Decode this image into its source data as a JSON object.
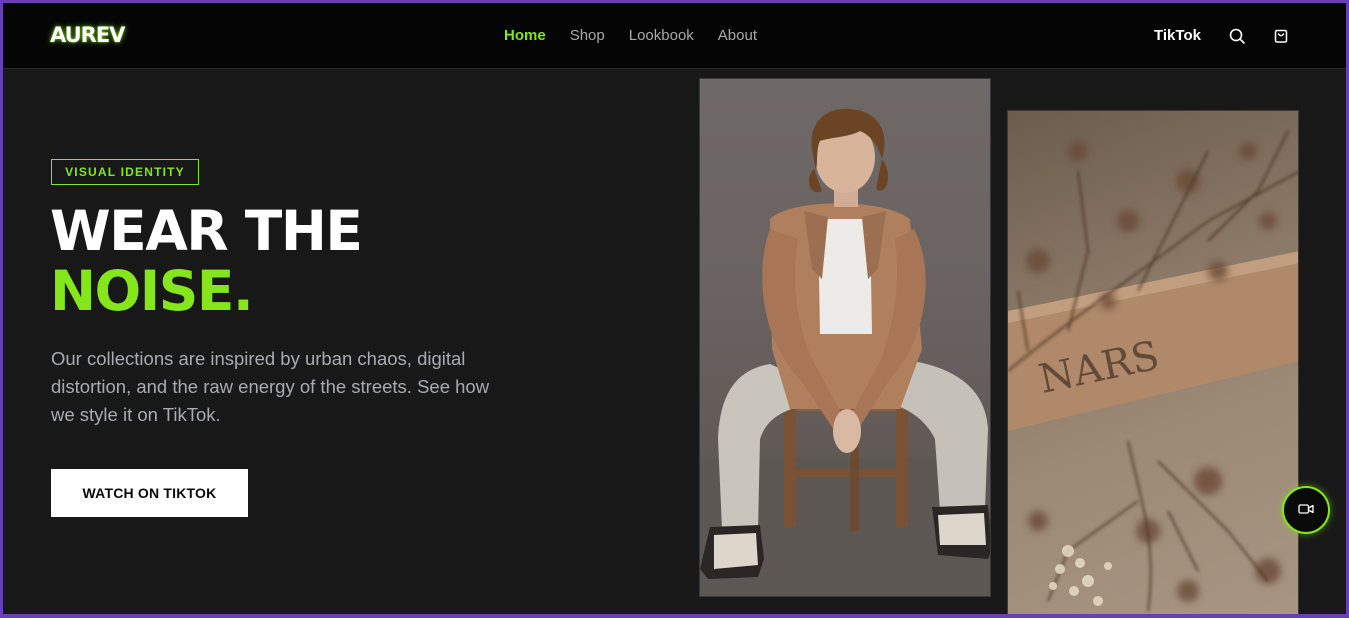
{
  "brand": {
    "logo": "AUREV",
    "accent_color": "#84e61b"
  },
  "nav": {
    "items": [
      {
        "label": "Home",
        "active": true
      },
      {
        "label": "Shop",
        "active": false
      },
      {
        "label": "Lookbook",
        "active": false
      },
      {
        "label": "About",
        "active": false
      }
    ],
    "tiktok_label": "TikTok",
    "search_icon": "search-icon",
    "cart_icon": "shopping-bag-icon"
  },
  "hero": {
    "tag": "VISUAL IDENTITY",
    "headline_line1": "WEAR THE",
    "headline_line2": "NOISE.",
    "lede": "Our collections are inspired by urban chaos, digital distortion, and the raw energy of the streets. See how we style it on TikTok.",
    "cta_label": "WATCH ON TIKTOK"
  },
  "gallery": {
    "images": [
      {
        "name": "model-photo",
        "alt": ""
      },
      {
        "name": "product-photo",
        "alt": ""
      }
    ],
    "product_text": "NARS"
  },
  "fab": {
    "icon": "video-camera-icon"
  }
}
